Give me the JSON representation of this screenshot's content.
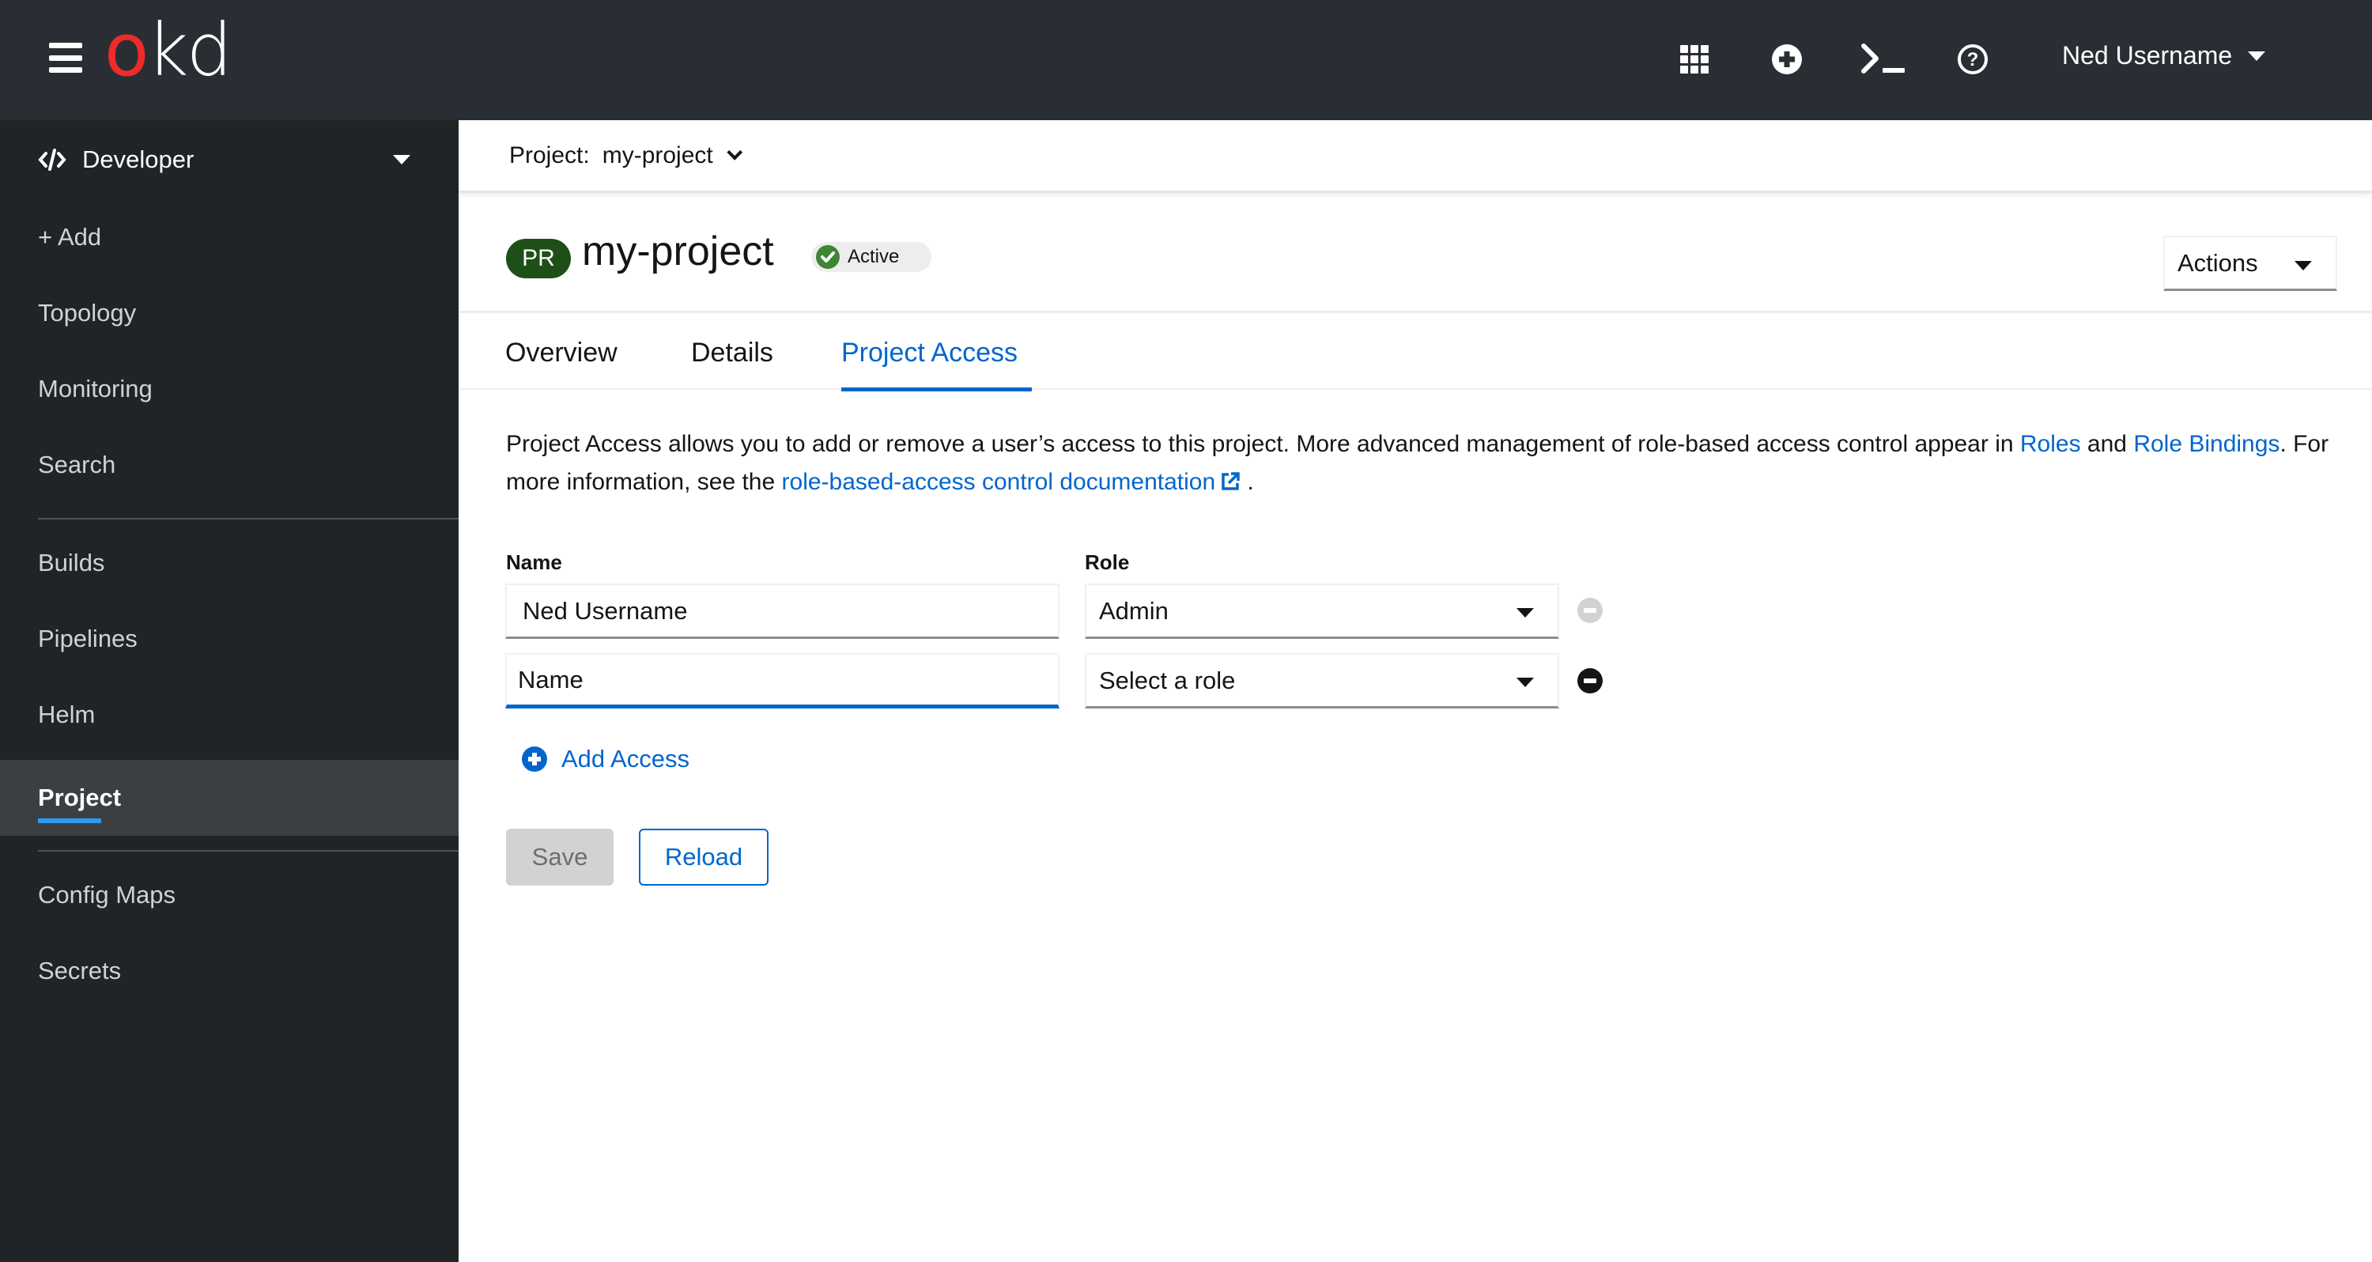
{
  "masthead": {
    "logo_prefix": "o",
    "logo_suffix": "kd",
    "icons": [
      "app-launcher-icon",
      "import-plus-icon",
      "terminal-icon",
      "help-icon"
    ],
    "user_name": "Ned Username"
  },
  "sidebar": {
    "perspective": "Developer",
    "groups": [
      [
        {
          "label": "+ Add"
        },
        {
          "label": "Topology"
        },
        {
          "label": "Monitoring"
        },
        {
          "label": "Search"
        }
      ],
      [
        {
          "label": "Builds"
        },
        {
          "label": "Pipelines"
        },
        {
          "label": "Helm"
        },
        {
          "label": "Project",
          "active": true
        }
      ],
      [
        {
          "label": "Config Maps"
        },
        {
          "label": "Secrets"
        }
      ]
    ]
  },
  "project_bar": {
    "label": "Project:",
    "value": "my-project"
  },
  "header": {
    "badge": "PR",
    "title": "my-project",
    "status": "Active",
    "status_color": "#3e8635",
    "actions_label": "Actions"
  },
  "tabs": [
    {
      "label": "Overview",
      "active": false
    },
    {
      "label": "Details",
      "active": false
    },
    {
      "label": "Project Access",
      "active": true
    }
  ],
  "description": {
    "part1": "Project Access allows you to add or remove a user’s access to this project.  More advanced management of role-based access control appear in ",
    "link_roles": "Roles",
    "part2": " and ",
    "link_role_bindings": "Role Bindings",
    "part3": ".  For more information, see the ",
    "link_docs": "role-based-access control documentation",
    "part4": " ."
  },
  "form": {
    "name_label": "Name",
    "role_label": "Role",
    "rows": [
      {
        "name_value": "Ned Username",
        "name_placeholder": "Name",
        "role": "Admin",
        "remove_enabled": false
      },
      {
        "name_value": "",
        "name_placeholder": "Name",
        "role": "Select a role",
        "remove_enabled": true
      }
    ],
    "add_access_label": "Add Access",
    "save_label": "Save",
    "reload_label": "Reload"
  },
  "colors": {
    "accent": "#0066cc",
    "masthead_bg": "#292e34",
    "sidebar_bg": "#212427",
    "logo_red": "#ee2a2a",
    "badge_green": "#1e4f18"
  }
}
